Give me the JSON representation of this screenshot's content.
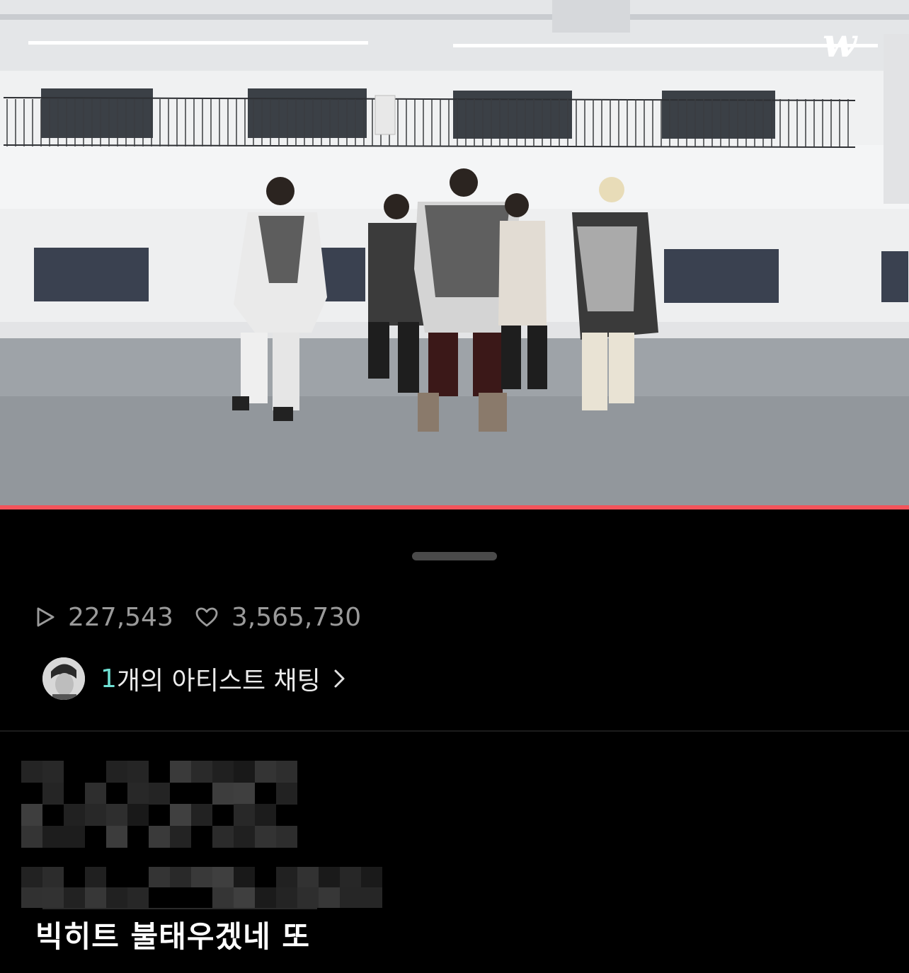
{
  "video": {
    "platform_logo": "w",
    "progress_fraction": 1.0,
    "accent_color": "#f2545b"
  },
  "stats": {
    "plays_icon": "play-outline-icon",
    "plays": "227,543",
    "likes_icon": "heart-outline-icon",
    "likes": "3,565,730"
  },
  "artist_chat": {
    "count": "1",
    "label": "개의 아티스트 채팅",
    "chevron_icon": "chevron-right-icon",
    "count_color": "#6fe0d3"
  },
  "comment": {
    "text": "빅히트 불태우겠네 또"
  }
}
